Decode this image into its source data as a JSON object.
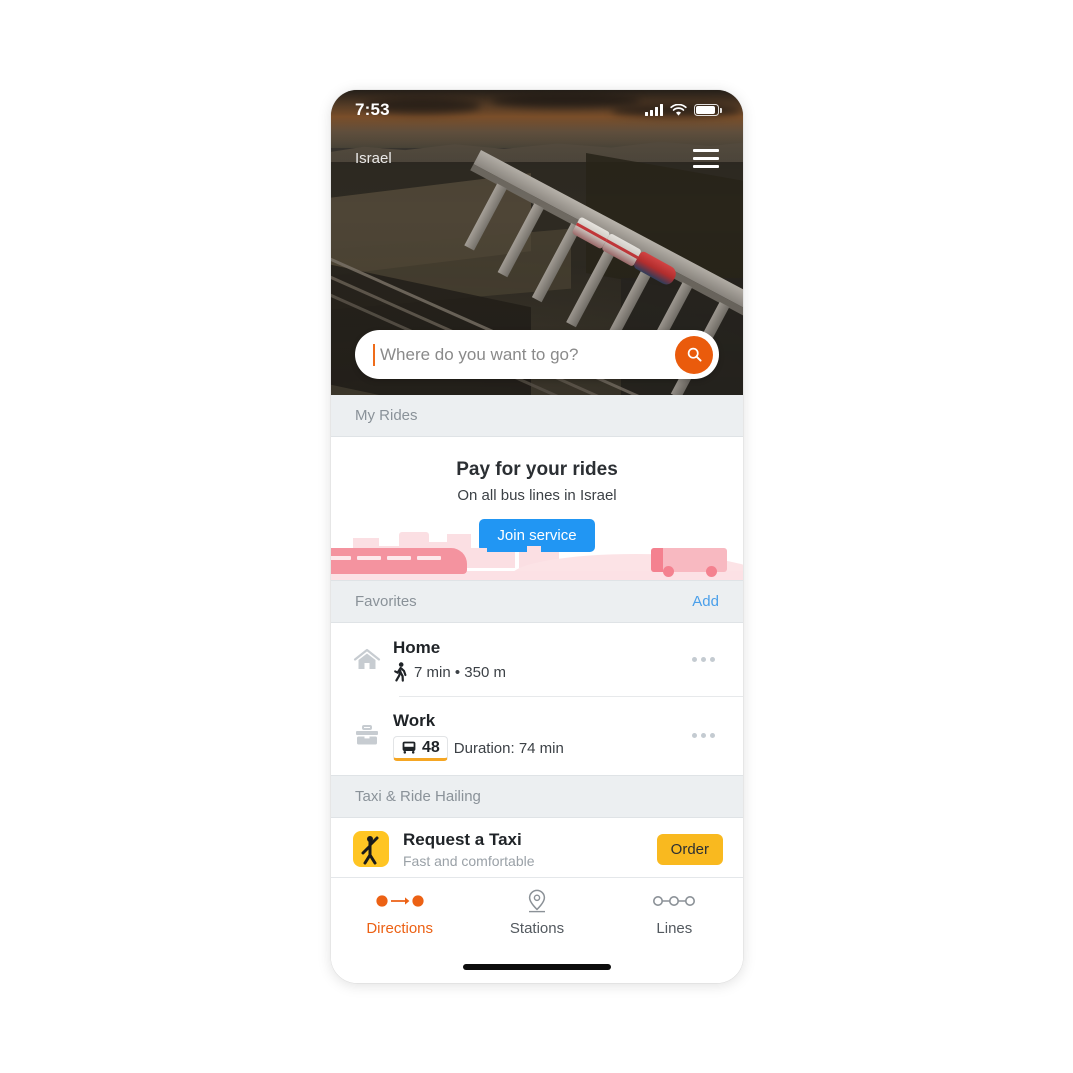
{
  "status_bar": {
    "time": "7:53",
    "icons": [
      "signal-icon",
      "wifi-icon",
      "battery-icon"
    ]
  },
  "hero": {
    "region_label": "Israel",
    "menu_icon": "hamburger-menu-icon",
    "image_description": "aerial photo of a red and white passenger train crossing a concrete viaduct at dusk"
  },
  "search": {
    "placeholder": "Where do you want to go?",
    "value": "",
    "button_icon": "search-icon",
    "accent_color": "#ea5b0c"
  },
  "sections": {
    "my_rides": {
      "title": "My Rides",
      "promo": {
        "title": "Pay for your rides",
        "subtitle": "On all bus lines in Israel",
        "button_label": "Join service",
        "button_color": "#2196f3"
      }
    },
    "favorites": {
      "title": "Favorites",
      "action_label": "Add",
      "action_color": "#4a9fea",
      "items": [
        {
          "name": "Home",
          "icon": "house-icon",
          "mode_icon": "walking-icon",
          "meta": "7 min • 350 m",
          "menu_icon": "more-options-icon"
        },
        {
          "name": "Work",
          "icon": "briefcase-icon",
          "mode_icon": "bus-icon",
          "line_number": "48",
          "meta": "Duration: 74 min",
          "menu_icon": "more-options-icon",
          "line_accent_color": "#f5a623"
        }
      ]
    },
    "taxi": {
      "title": "Taxi & Ride Hailing",
      "items": [
        {
          "title": "Request a Taxi",
          "subtitle": "Fast and comfortable",
          "icon": "taxi-hail-icon",
          "button_label": "Order",
          "button_color": "#f9b91f"
        }
      ]
    }
  },
  "tab_bar": {
    "tabs": [
      {
        "label": "Directions",
        "icon": "directions-icon",
        "active": true
      },
      {
        "label": "Stations",
        "icon": "map-pin-icon",
        "active": false
      },
      {
        "label": "Lines",
        "icon": "lines-icon",
        "active": false
      }
    ],
    "active_color": "#ec6114",
    "inactive_color": "#53595f"
  }
}
